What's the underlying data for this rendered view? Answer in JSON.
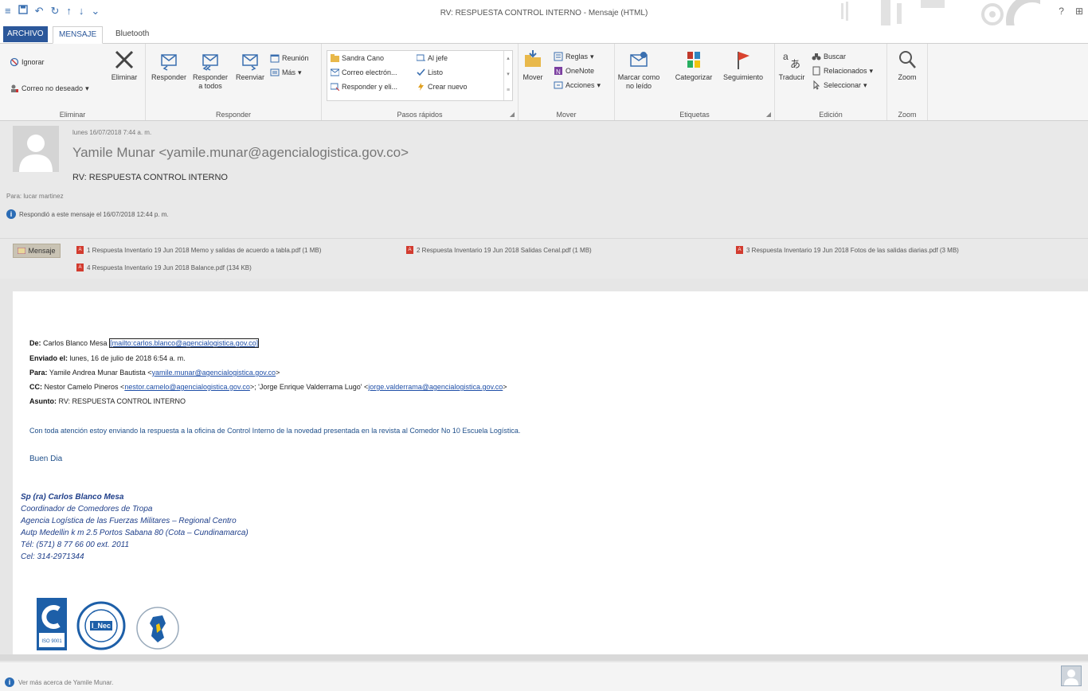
{
  "window": {
    "title": "RV: RESPUESTA CONTROL INTERNO - Mensaje (HTML)",
    "controls": [
      "?",
      "⊞"
    ]
  },
  "qat": [
    "≡",
    "💾",
    "↶",
    "↻",
    "↑",
    "↓",
    "⌄"
  ],
  "tabs": {
    "file": "ARCHIVO",
    "message": "MENSAJE",
    "bluetooth": "Bluetooth"
  },
  "ribbon": {
    "eliminar": {
      "label": "Eliminar",
      "ignore": "Ignorar",
      "junk": "Correo no deseado",
      "delete": "Eliminar"
    },
    "responder": {
      "label": "Responder",
      "reply": "Responder",
      "reply_all": "Responder a todos",
      "forward": "Reenviar",
      "meeting": "Reunión",
      "more": "Más"
    },
    "quick_steps": {
      "label": "Pasos rápidos",
      "items": [
        "Sandra Cano",
        "Al jefe",
        "Correo electrón...",
        "Listo",
        "Responder y eli...",
        "Crear nuevo"
      ]
    },
    "mover": {
      "label": "Mover",
      "move": "Mover",
      "rules": "Reglas",
      "onenote": "OneNote",
      "actions": "Acciones"
    },
    "etiquetas": {
      "label": "Etiquetas",
      "mark_unread": "Marcar como no leído",
      "categorize": "Categorizar",
      "followup": "Seguimiento"
    },
    "edicion": {
      "label": "Edición",
      "translate": "Traducir",
      "find": "Buscar",
      "related": "Relacionados",
      "select": "Seleccionar"
    },
    "zoom": {
      "label": "Zoom",
      "zoom": "Zoom"
    }
  },
  "header": {
    "date": "lunes 16/07/2018 7:44 a. m.",
    "from": "Yamile Munar <yamile.munar@agencialogistica.gov.co>",
    "subject": "RV: RESPUESTA CONTROL INTERNO",
    "to": "Para: lucar martinez",
    "replied": "Respondió a este mensaje el 16/07/2018 12:44 p. m."
  },
  "attachments": {
    "message_button": "Mensaje",
    "items": [
      "1 Respuesta Inventario 19 Jun 2018 Memo y salidas de acuerdo a tabla.pdf (1 MB)",
      "2 Respuesta Inventario 19 Jun 2018 Salidas Cenal.pdf (1 MB)",
      "3 Respuesta Inventario 19 Jun 2018 Fotos de las salidas diarias.pdf (3 MB)",
      "4 Respuesta Inventario 19 Jun 2018 Balance.pdf (134 KB)"
    ]
  },
  "body": {
    "de_label": "De:",
    "de_name": "Carlos Blanco Mesa",
    "de_link": "[mailto:carlos.blanco@agencialogistica.gov.co]",
    "enviado_label": "Enviado el:",
    "enviado_value": "lunes, 16 de julio de 2018 6:54 a. m.",
    "para_label": "Para:",
    "para_name": "Yamile Andrea Munar Bautista <",
    "para_link": "yamile.munar@agencialogistica.gov.co",
    "para_end": ">",
    "cc_label": "CC:",
    "cc_name1": "Nestor Camelo Pineros <",
    "cc_link1": "nestor.camelo@agencialogistica.gov.co",
    "cc_mid": ">; 'Jorge Enrique Valderrama Lugo' <",
    "cc_link2": "jorge.valderrama@agencialogistica.gov.co",
    "cc_end": ">",
    "asunto_label": "Asunto:",
    "asunto_value": "RV: RESPUESTA CONTROL INTERNO",
    "text": "Con toda atención estoy enviando la respuesta a la oficina de Control Interno de la novedad presentada en la revista al Comedor No 10 Escuela Logística.",
    "greeting": "Buen Dia",
    "signature": {
      "name": "Sp (ra) Carlos Blanco Mesa",
      "role": "Coordinador de Comedores de Tropa",
      "org": "Agencia Logística de las Fuerzas Militares – Regional Centro",
      "address": "Autp Medellin k m 2.5 Portos Sabana 80 (Cota – Cundinamarca)",
      "tel": "Tél: (571) 8 77 66 00 ext. 2011",
      "cel": "Cel: 314-2971344"
    },
    "logo_text": "ISO 9001",
    "logo2_text": "I_Nec"
  },
  "footer": {
    "more": "Ver más acerca de Yamile Munar."
  }
}
